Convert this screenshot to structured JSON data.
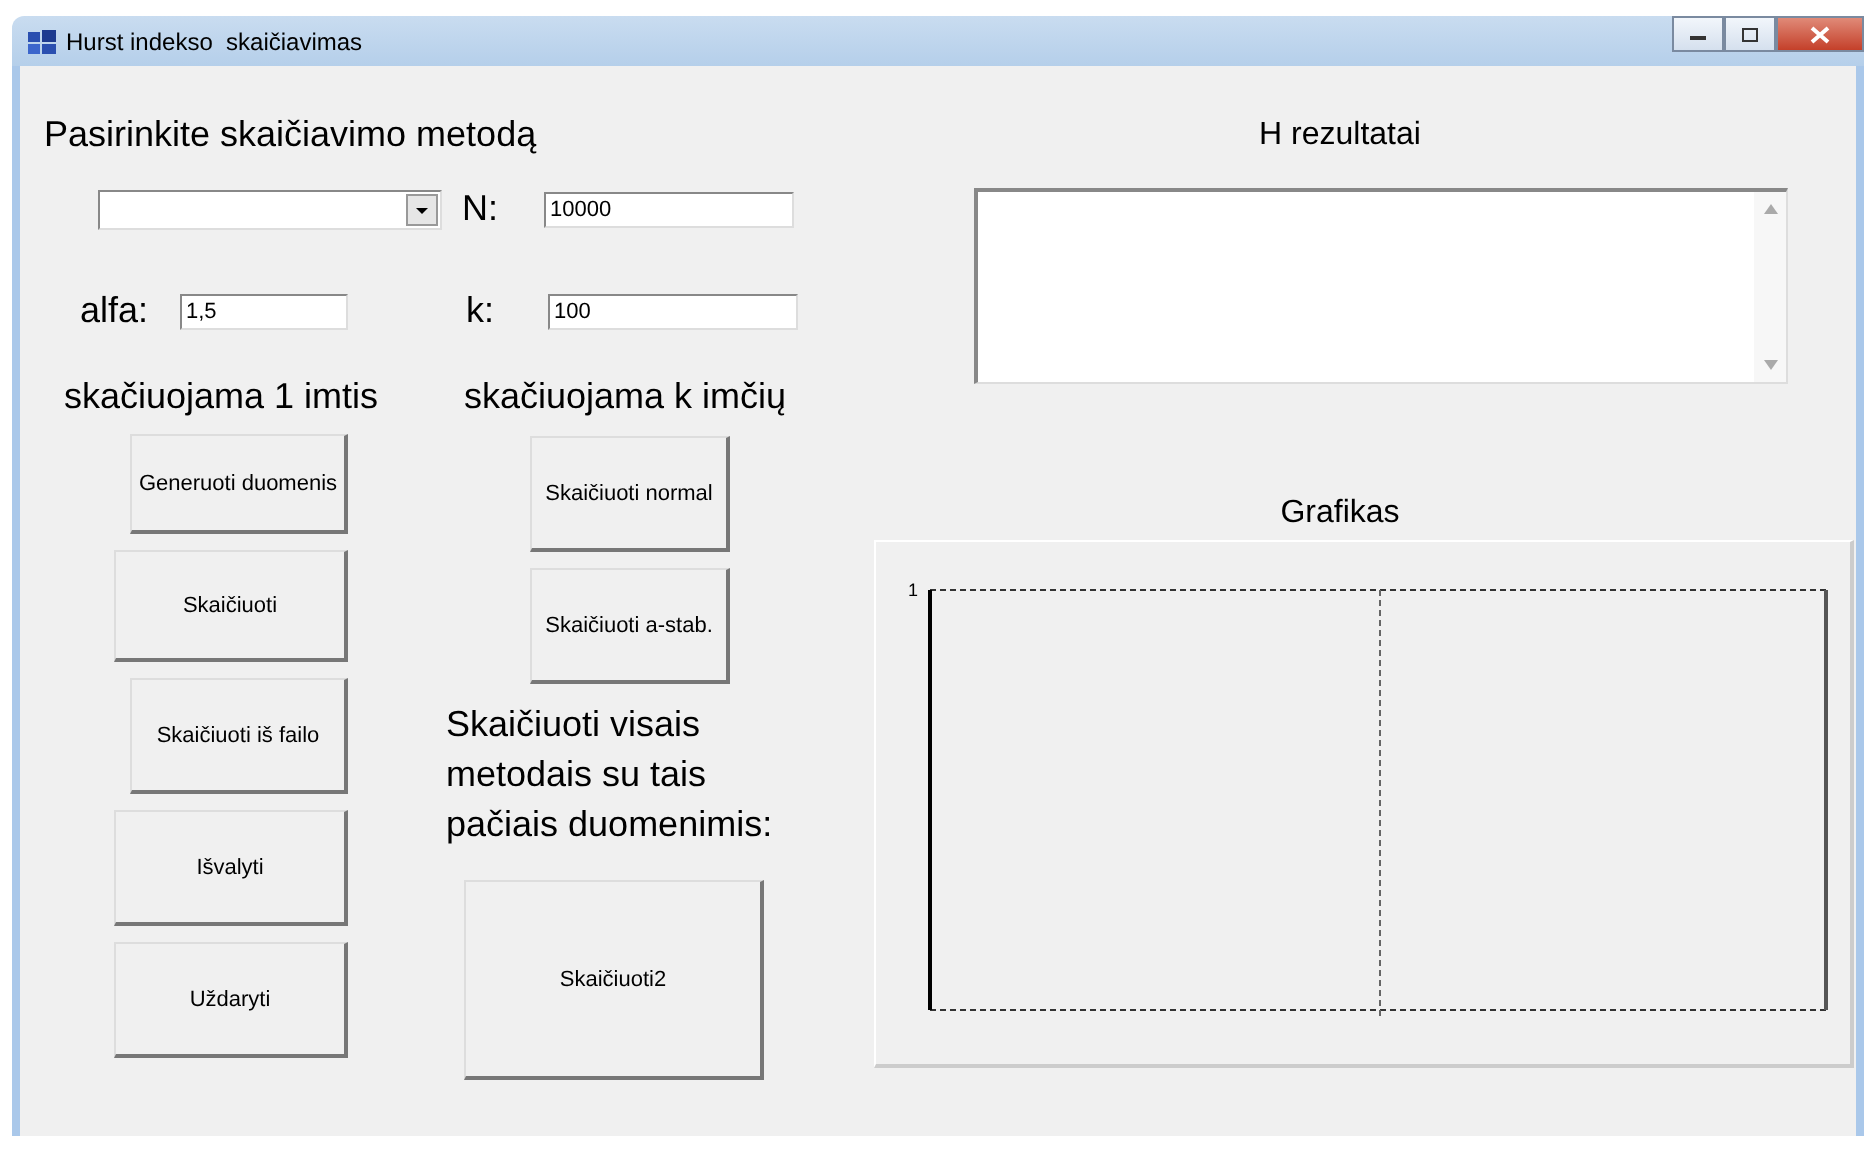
{
  "window": {
    "title": "Hurst indekso  skaičiavimas"
  },
  "method": {
    "heading": "Pasirinkite skaičiavimo metodą"
  },
  "params": [
    {
      "label": "N:",
      "value": "10000"
    },
    {
      "label": "alfa:",
      "value": "1,5"
    },
    {
      "label": "k:",
      "value": "100"
    }
  ],
  "single_sample": {
    "heading": "skačiuojama 1 imtis",
    "buttons": [
      "Generuoti duomenis",
      "Skaičiuoti",
      "Skaičiuoti iš failo",
      "Išvalyti",
      "Uždaryti"
    ]
  },
  "k_samples": {
    "heading": "skačiuojama k imčių",
    "buttons": [
      "Skaičiuoti normal",
      "Skaičiuoti a-stab."
    ]
  },
  "all_methods": {
    "text": "Skaičiuoti visais metodais su tais pačiais duomenimis:",
    "button": "Skaičiuoti2"
  },
  "results": {
    "heading": "H rezultatai"
  },
  "graph": {
    "heading": "Grafikas",
    "y_tick": "1"
  }
}
